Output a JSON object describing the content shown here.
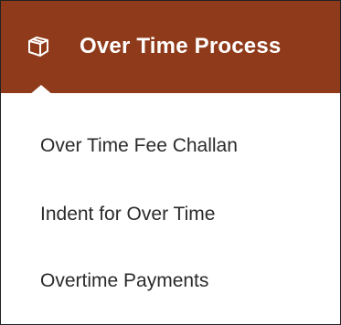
{
  "colors": {
    "header_bg": "#8f3a1a",
    "header_text": "#ffffff",
    "menu_text": "#2b2b2b",
    "background": "#ffffff"
  },
  "header": {
    "icon": "cube-icon",
    "title": "Over Time Process"
  },
  "menu": {
    "items": [
      {
        "label": "Over Time Fee Challan"
      },
      {
        "label": "Indent for Over Time"
      },
      {
        "label": "Overtime Payments"
      }
    ]
  }
}
